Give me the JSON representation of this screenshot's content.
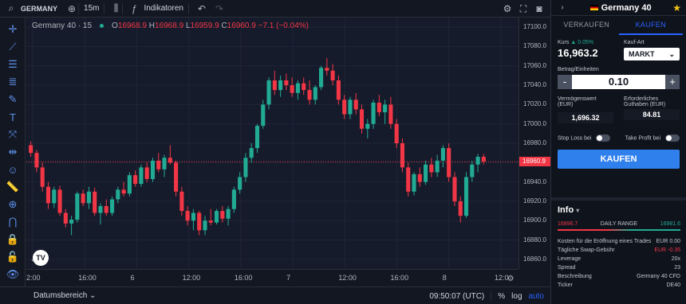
{
  "toolbar": {
    "symbol": "GERMANY",
    "interval": "15m",
    "indicators": "Indikatoren"
  },
  "legend": {
    "title": "Germany 40 · 15",
    "o_label": "O",
    "o": "16968.9",
    "h_label": "H",
    "h": "16968.9",
    "l_label": "L",
    "l": "16959.9",
    "c_label": "C",
    "c": "16960.9",
    "change": "−7.1 (−0.04%)"
  },
  "price_axis": {
    "ticks": [
      "17100.0",
      "17080.0",
      "17060.0",
      "17040.0",
      "17020.0",
      "17000.0",
      "16980.0",
      "16960.0",
      "16940.0",
      "16920.0",
      "16900.0",
      "16880.0",
      "16860.0"
    ],
    "last_price": "16960.9"
  },
  "time_axis": {
    "ticks": [
      "2:00",
      "16:00",
      "6",
      "12:00",
      "16:00",
      "7",
      "12:00",
      "16:00",
      "8",
      "12:0"
    ]
  },
  "bottom": {
    "range": "Datumsbereich",
    "clock": "09:50:07 (UTC)",
    "pct": "%",
    "log": "log",
    "auto": "auto"
  },
  "panel": {
    "title": "Germany 40",
    "tab_sell": "VERKAUFEN",
    "tab_buy": "KAUFEN",
    "kurs_label": "Kurs",
    "kurs_change": "▲ 0.05%",
    "kurs_value": "16,963.2",
    "kaufart_label": "Kauf-Art",
    "kaufart_value": "MARKT",
    "amount_label": "Betrag/Einheiten",
    "amount_value": "0.10",
    "minus": "-",
    "plus": "+",
    "vermoegen_label": "Vermögenswert (EUR)",
    "vermoegen_value": "1,696.32",
    "erforderlich_label": "Erforderliches",
    "guthaben_label": "Guthaben (EUR)",
    "guthaben_value": "84.81",
    "stoploss_label": "Stop Loss bei",
    "takeprofit_label": "Take Profit bei",
    "buy_button": "KAUFEN"
  },
  "info": {
    "title": "Info",
    "range_low": "16896.7",
    "range_label": "DAILY RANGE",
    "range_high": "16981.6",
    "rows": [
      {
        "label": "Kosten für die Eröffnung eines Trades",
        "value": "EUR 0.00"
      },
      {
        "label": "Tägliche Swap-Gebühr",
        "value": "EUR -0.35"
      },
      {
        "label": "Leverage",
        "value": "20x"
      },
      {
        "label": "Spread",
        "value": "23"
      },
      {
        "label": "Beschreibung",
        "value": "Germany 40 CFD"
      },
      {
        "label": "Ticker",
        "value": "DE40"
      }
    ]
  },
  "colors": {
    "up": "#22ab94",
    "down": "#f23645",
    "accent": "#2962ff"
  },
  "chart_data": {
    "type": "candlestick",
    "ylim": [
      16850,
      17110
    ],
    "candles": [
      [
        16978,
        16982,
        16966,
        16970
      ],
      [
        16970,
        16973,
        16950,
        16955
      ],
      [
        16955,
        16960,
        16930,
        16935
      ],
      [
        16935,
        16940,
        16912,
        16918
      ],
      [
        16918,
        16935,
        16913,
        16932
      ],
      [
        16932,
        16936,
        16905,
        16908
      ],
      [
        16908,
        16912,
        16893,
        16897
      ],
      [
        16897,
        16905,
        16885,
        16901
      ],
      [
        16901,
        16930,
        16898,
        16928
      ],
      [
        16928,
        16932,
        16915,
        16918
      ],
      [
        16918,
        16935,
        16912,
        16930
      ],
      [
        16930,
        16934,
        16905,
        16908
      ],
      [
        16908,
        16918,
        16896,
        16915
      ],
      [
        16915,
        16922,
        16905,
        16908
      ],
      [
        16908,
        16925,
        16905,
        16922
      ],
      [
        16922,
        16935,
        16918,
        16932
      ],
      [
        16932,
        16940,
        16925,
        16928
      ],
      [
        16928,
        16950,
        16925,
        16947
      ],
      [
        16947,
        16952,
        16935,
        16938
      ],
      [
        16938,
        16958,
        16935,
        16955
      ],
      [
        16955,
        16960,
        16940,
        16943
      ],
      [
        16943,
        16965,
        16940,
        16962
      ],
      [
        16962,
        16970,
        16950,
        16953
      ],
      [
        16953,
        16968,
        16945,
        16965
      ],
      [
        16965,
        16978,
        16958,
        16960
      ],
      [
        16960,
        16962,
        16925,
        16930
      ],
      [
        16930,
        16935,
        16905,
        16910
      ],
      [
        16910,
        16915,
        16895,
        16900
      ],
      [
        16900,
        16912,
        16890,
        16908
      ],
      [
        16908,
        16910,
        16885,
        16890
      ],
      [
        16890,
        16905,
        16885,
        16900
      ],
      [
        16900,
        16912,
        16895,
        16898
      ],
      [
        16898,
        16912,
        16896,
        16910
      ],
      [
        16910,
        16915,
        16898,
        16902
      ],
      [
        16902,
        16915,
        16895,
        16912
      ],
      [
        16912,
        16935,
        16908,
        16932
      ],
      [
        16932,
        16950,
        16928,
        16945
      ],
      [
        16945,
        16970,
        16940,
        16965
      ],
      [
        16965,
        16980,
        16960,
        16975
      ],
      [
        16975,
        17000,
        16970,
        16998
      ],
      [
        16998,
        17025,
        16995,
        17020
      ],
      [
        17020,
        17048,
        17015,
        17045
      ],
      [
        17045,
        17055,
        17030,
        17035
      ],
      [
        17035,
        17050,
        17028,
        17045
      ],
      [
        17045,
        17052,
        17035,
        17040
      ],
      [
        17040,
        17048,
        17028,
        17032
      ],
      [
        17032,
        17045,
        17025,
        17042
      ],
      [
        17042,
        17048,
        17030,
        17035
      ],
      [
        17035,
        17045,
        17020,
        17025
      ],
      [
        17025,
        17040,
        17020,
        17038
      ],
      [
        17038,
        17060,
        17035,
        17058
      ],
      [
        17058,
        17068,
        17050,
        17055
      ],
      [
        17055,
        17062,
        17040,
        17045
      ],
      [
        17045,
        17050,
        17020,
        17025
      ],
      [
        17025,
        17030,
        17005,
        17010
      ],
      [
        17010,
        17028,
        17005,
        17025
      ],
      [
        17025,
        17032,
        17010,
        17015
      ],
      [
        17015,
        17020,
        16990,
        16995
      ],
      [
        16995,
        17005,
        16985,
        17000
      ],
      [
        17000,
        17025,
        16995,
        17022
      ],
      [
        17022,
        17030,
        17008,
        17012
      ],
      [
        17012,
        17025,
        17000,
        17020
      ],
      [
        17020,
        17028,
        16995,
        17000
      ],
      [
        17000,
        17005,
        16975,
        16980
      ],
      [
        16980,
        16985,
        16950,
        16955
      ],
      [
        16955,
        16960,
        16925,
        16930
      ],
      [
        16930,
        16950,
        16926,
        16948
      ],
      [
        16948,
        16955,
        16935,
        16940
      ],
      [
        16940,
        16962,
        16937,
        16958
      ],
      [
        16958,
        16965,
        16945,
        16950
      ],
      [
        16950,
        16968,
        16945,
        16962
      ],
      [
        16962,
        16978,
        16955,
        16975
      ],
      [
        16975,
        16980,
        16940,
        16945
      ],
      [
        16945,
        16950,
        16915,
        16920
      ],
      [
        16920,
        16925,
        16898,
        16905
      ],
      [
        16905,
        16950,
        16903,
        16945
      ],
      [
        16945,
        16962,
        16940,
        16958
      ],
      [
        16958,
        16969,
        16950,
        16966
      ],
      [
        16966,
        16969,
        16958,
        16961
      ]
    ]
  }
}
